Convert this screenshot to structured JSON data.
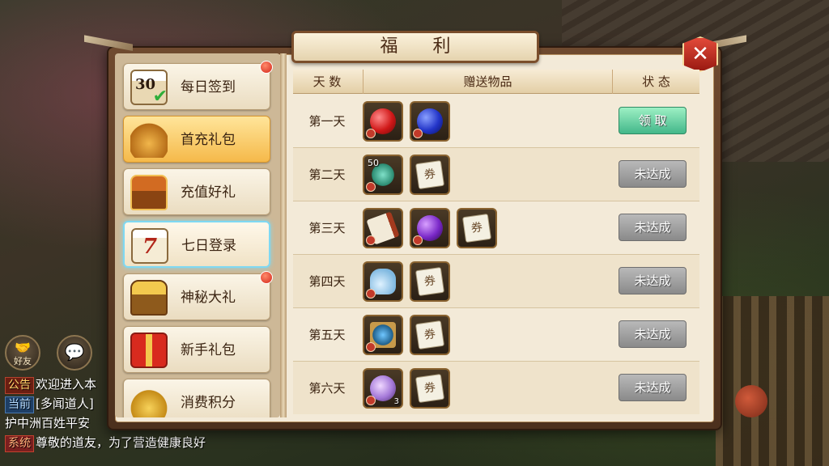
{
  "title": "福 利",
  "sidebar": {
    "items": [
      {
        "label": "每日签到",
        "icon": "calendar-30-icon",
        "badge": true
      },
      {
        "label": "首充礼包",
        "icon": "money-bag-icon",
        "badge": false
      },
      {
        "label": "充值好礼",
        "icon": "treasure-chest-icon",
        "badge": false
      },
      {
        "label": "七日登录",
        "icon": "calendar-7-icon",
        "badge": false
      },
      {
        "label": "神秘大礼",
        "icon": "open-chest-icon",
        "badge": true
      },
      {
        "label": "新手礼包",
        "icon": "gift-box-icon",
        "badge": false
      },
      {
        "label": "消费积分",
        "icon": "gold-coins-icon",
        "badge": false
      }
    ],
    "calendar_number": "30",
    "calendar7_number": "7"
  },
  "table": {
    "headers": {
      "day": "天 数",
      "items": "赠送物品",
      "status": "状 态"
    },
    "rows": [
      {
        "day": "第一天",
        "status": "领 取",
        "items": [
          {
            "icon": "red-orb-icon"
          },
          {
            "icon": "blue-orb-icon"
          }
        ]
      },
      {
        "day": "第二天",
        "status": "未达成",
        "items": [
          {
            "icon": "jade-pendant-icon",
            "count": "50"
          },
          {
            "icon": "ticket-icon"
          }
        ]
      },
      {
        "day": "第三天",
        "status": "未达成",
        "items": [
          {
            "icon": "scroll-icon"
          },
          {
            "icon": "purple-orb-icon"
          },
          {
            "icon": "ticket-icon"
          }
        ]
      },
      {
        "day": "第四天",
        "status": "未达成",
        "items": [
          {
            "icon": "vase-icon"
          },
          {
            "icon": "ticket-icon"
          }
        ]
      },
      {
        "day": "第五天",
        "status": "未达成",
        "items": [
          {
            "icon": "skill-book-icon"
          },
          {
            "icon": "ticket-icon"
          }
        ]
      },
      {
        "day": "第六天",
        "status": "未达成",
        "items": [
          {
            "icon": "purple-gem-icon",
            "count": "3"
          },
          {
            "icon": "ticket-icon"
          }
        ]
      }
    ],
    "ticket_glyph": "券"
  },
  "chat": {
    "friend_label": "好友",
    "lines": [
      {
        "tag": "公告",
        "text": "欢迎进入本"
      },
      {
        "tag": "当前",
        "text": "[多闻道人]"
      },
      {
        "tag": "",
        "text": "护中洲百姓平安"
      },
      {
        "tag": "系统",
        "text": "尊敬的道友，为了营造健康良好"
      }
    ]
  },
  "colors": {
    "claim_button": "#43b78a",
    "disabled_button": "#8a8a8a",
    "badge": "#d3261a"
  }
}
